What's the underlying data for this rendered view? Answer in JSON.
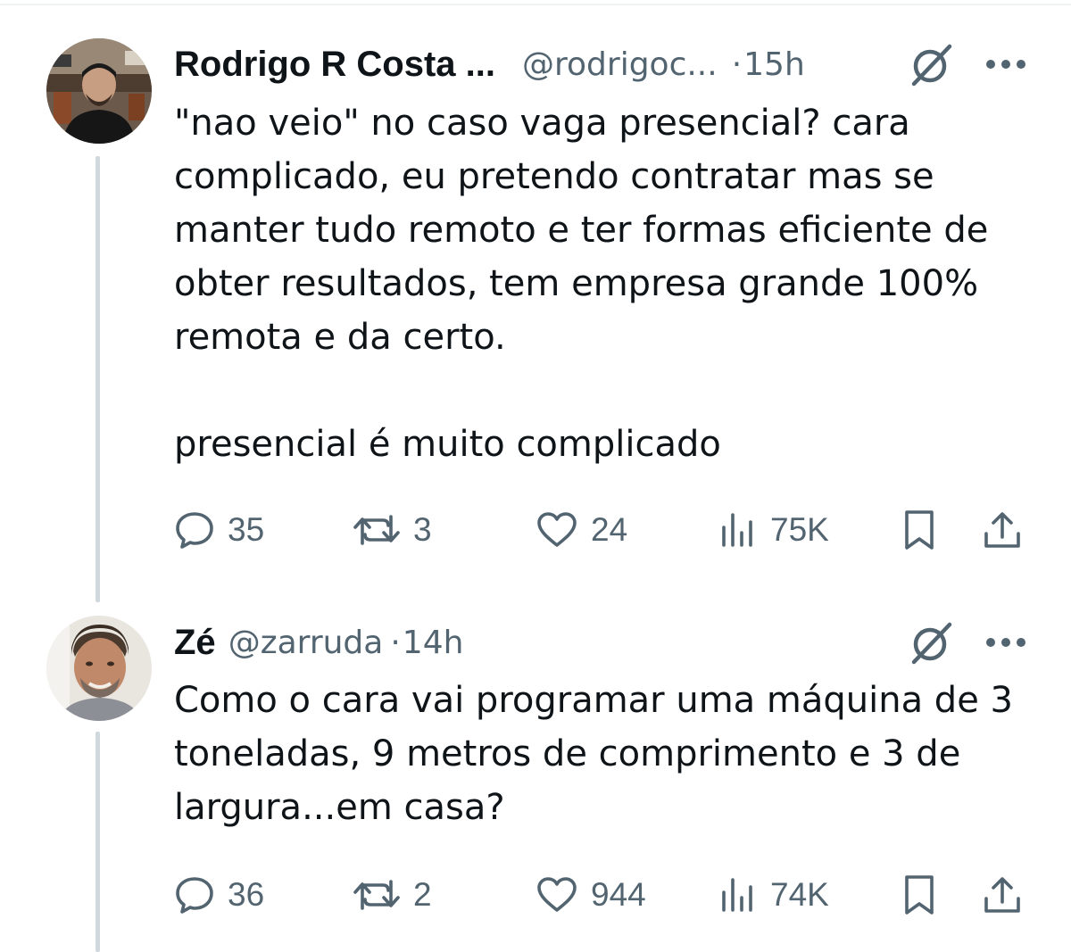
{
  "tweets": [
    {
      "display_name": "Rodrigo R Costa ...",
      "handle": "@rodrigoc...",
      "separator": "·",
      "time": "15h",
      "body": "\"nao veio\" no caso vaga presencial? cara\ncomplicado, eu pretendo contratar mas se\nmanter tudo remoto e ter formas eficiente de\nobter resultados, tem empresa grande 100%\nremota e da certo.\n\npresencial é muito complicado",
      "replies": "35",
      "reposts": "3",
      "likes": "24",
      "views": "75K"
    },
    {
      "display_name": "Zé",
      "handle": "@zarruda",
      "separator": "·",
      "time": "14h",
      "body": "Como o cara vai programar uma máquina de 3\ntoneladas, 9 metros de comprimento e 3 de\nlargura...em casa?",
      "replies": "36",
      "reposts": "2",
      "likes": "944",
      "views": "74K"
    }
  ],
  "icons": {
    "grok": "grok-icon",
    "more": "more-icon",
    "reply": "reply-icon",
    "repost": "repost-icon",
    "like": "heart-icon",
    "views": "views-icon",
    "bookmark": "bookmark-icon",
    "share": "share-icon"
  },
  "colors": {
    "text": "#0f1419",
    "secondary": "#536471",
    "thread_line": "#cfd9de",
    "background": "#ffffff"
  }
}
